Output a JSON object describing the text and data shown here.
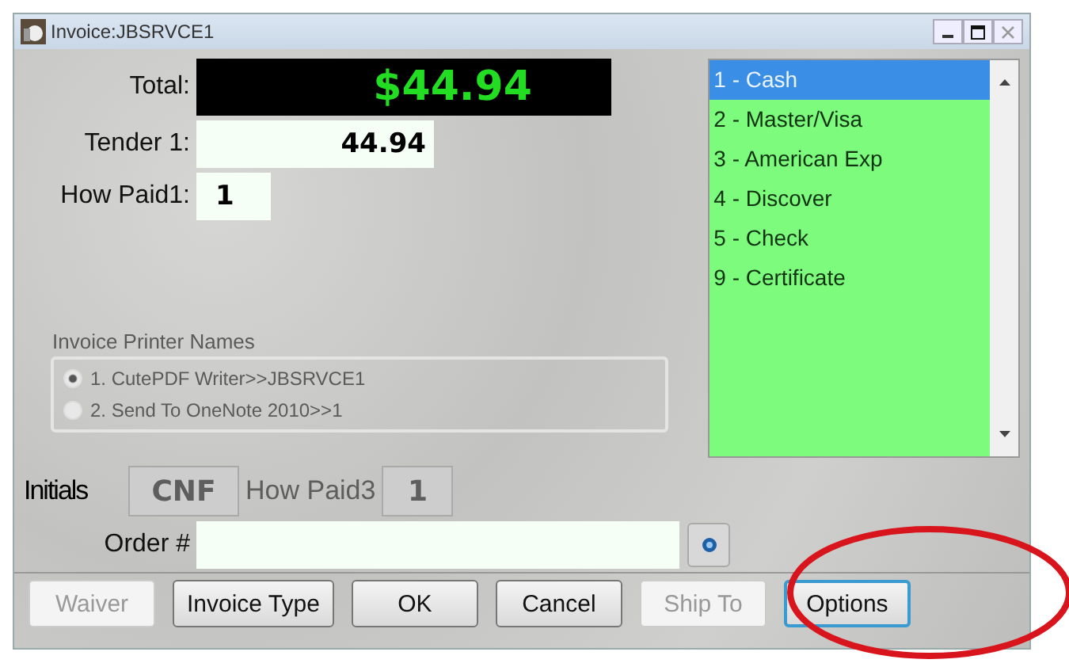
{
  "window": {
    "title": "Invoice:JBSRVCE1"
  },
  "total": {
    "label": "Total:",
    "value": "$44.94"
  },
  "tender": {
    "label": "Tender 1:",
    "value": "44.94"
  },
  "how_paid": {
    "label": "How Paid1:",
    "value": "1"
  },
  "payment_list": [
    {
      "label": "1 - Cash",
      "selected": true
    },
    {
      "label": "2 - Master/Visa",
      "selected": false
    },
    {
      "label": "3 - American Exp",
      "selected": false
    },
    {
      "label": "4 - Discover",
      "selected": false
    },
    {
      "label": "5 - Check",
      "selected": false
    },
    {
      "label": "9 - Certificate",
      "selected": false
    }
  ],
  "printer_group": {
    "title": "Invoice Printer Names",
    "disabled": true,
    "options": [
      {
        "label": "1. CutePDF Writer>>JBSRVCE1",
        "selected": true
      },
      {
        "label": "2. Send To OneNote 2010>>1",
        "selected": false
      }
    ]
  },
  "initials": {
    "label": "Initials",
    "value": "CNF",
    "disabled": true
  },
  "how_paid3": {
    "label": "How Paid3",
    "value": "1",
    "disabled": true
  },
  "order": {
    "label": "Order #"
  },
  "buttons": [
    {
      "label": "Waiver",
      "disabled": true,
      "focused": false
    },
    {
      "label": "Invoice Type",
      "disabled": false,
      "focused": false
    },
    {
      "label": "OK",
      "disabled": false,
      "focused": false
    },
    {
      "label": "Cancel",
      "disabled": false,
      "focused": false
    },
    {
      "label": "Ship To",
      "disabled": true,
      "focused": false
    },
    {
      "label": "Options",
      "disabled": false,
      "focused": true
    }
  ]
}
